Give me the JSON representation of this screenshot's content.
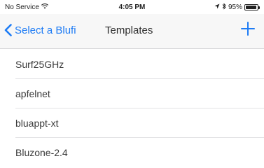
{
  "status_bar": {
    "carrier": "No Service",
    "time": "4:05 PM",
    "battery_percent": "95%",
    "battery_level": 0.95,
    "icons": [
      "wifi-icon",
      "location-arrow-icon",
      "bluetooth-icon",
      "battery-icon"
    ]
  },
  "nav": {
    "back_label": "Select a Blufi",
    "title": "Templates",
    "add_icon": "plus-icon",
    "accent_color": "#1e7cf5"
  },
  "templates": [
    {
      "label": "Surf25GHz"
    },
    {
      "label": "apfelnet"
    },
    {
      "label": "bluappt-xt"
    },
    {
      "label": "Bluzone-2.4"
    }
  ]
}
